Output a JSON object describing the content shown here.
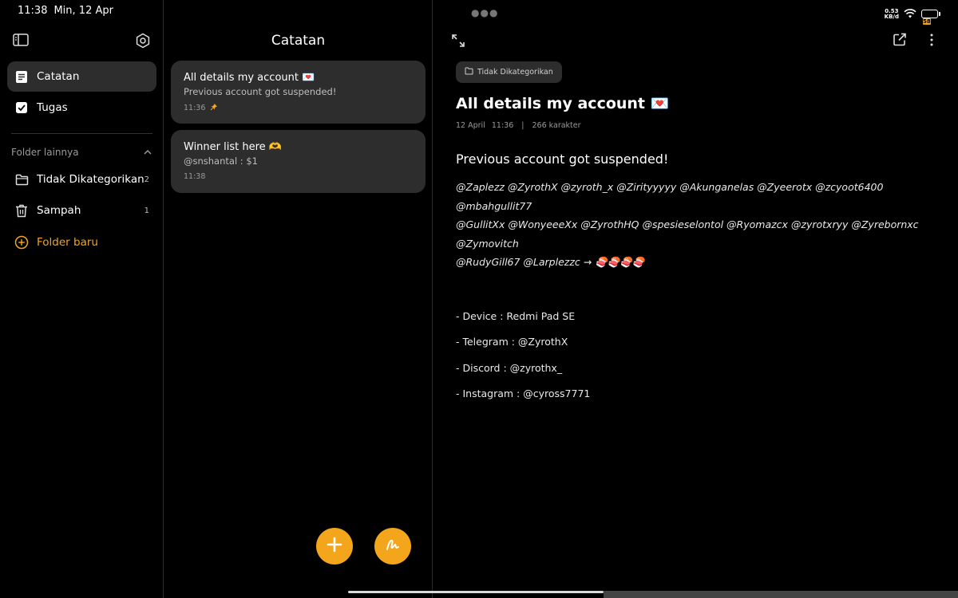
{
  "status_bar": {
    "time": "11:38",
    "date": "Min, 12 Apr",
    "net_speed_value": "0.53",
    "net_speed_unit": "KB/d",
    "battery_level": "58",
    "battery_fraction": 0.58
  },
  "sidebar": {
    "items": [
      {
        "label": "Catatan",
        "icon": "note-icon"
      },
      {
        "label": "Tugas",
        "icon": "checkbox-icon"
      }
    ],
    "folder_header": "Folder lainnya",
    "folders": [
      {
        "label": "Tidak Dikategorikan",
        "count": "2",
        "icon": "folder-icon"
      },
      {
        "label": "Sampah",
        "count": "1",
        "icon": "trash-icon"
      }
    ],
    "new_folder_label": "Folder baru"
  },
  "list": {
    "title": "Catatan",
    "notes": [
      {
        "title": "All details my account 💌",
        "preview": "Previous account got suspended!",
        "time": "11:36",
        "pinned": true
      },
      {
        "title": "Winner list here 🫶",
        "preview": "@snshantal : $1",
        "time": "11:38",
        "pinned": false
      }
    ]
  },
  "detail": {
    "category": "Tidak Dikategorikan",
    "title": "All details my account 💌",
    "date": "12 April",
    "time": "11:36",
    "chars": "266 karakter",
    "headline": "Previous account got suspended!",
    "mentions_1": "@Zaplezz @ZyrothX @zyroth_x @Zirityyyyy @Akunganelas @Zyeerotx @zcyoot6400 @mbahgullit77",
    "mentions_2": "@GullitXx @WonyeeeXx @ZyrothHQ @spesieselontol @Ryomazcx @zyrotxryy @Zyrebornxc @Zymovitch",
    "mentions_3": "@RudyGill67 @Larplezzc → 🍣🍣🍣🍣",
    "lines": [
      "- Device : Redmi Pad SE",
      "- Telegram : @ZyrothX",
      "- Discord : @zyrothx_",
      "- Instagram : @cyross7771"
    ]
  },
  "colors": {
    "accent": "#f3a51c",
    "background": "#000000",
    "card": "#2d2d2d"
  }
}
